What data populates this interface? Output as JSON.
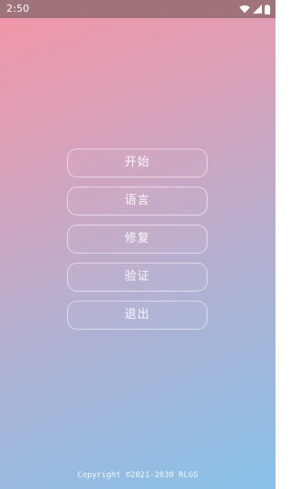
{
  "status_bar": {
    "time": "2:50",
    "icons": [
      "wifi-icon",
      "cellular-signal-icon",
      "battery-icon"
    ]
  },
  "menu": {
    "items": [
      {
        "label": "开始"
      },
      {
        "label": "语言"
      },
      {
        "label": "修复"
      },
      {
        "label": "验证"
      },
      {
        "label": "退出"
      }
    ]
  },
  "footer": {
    "copyright": "Copyright ©2021-2030 RLGG"
  },
  "colors": {
    "gradient_top_left": "#f496a6",
    "gradient_bottom_right": "#88c1e9",
    "status_bar_bg": "#a0727a",
    "button_border": "#ffffff"
  }
}
